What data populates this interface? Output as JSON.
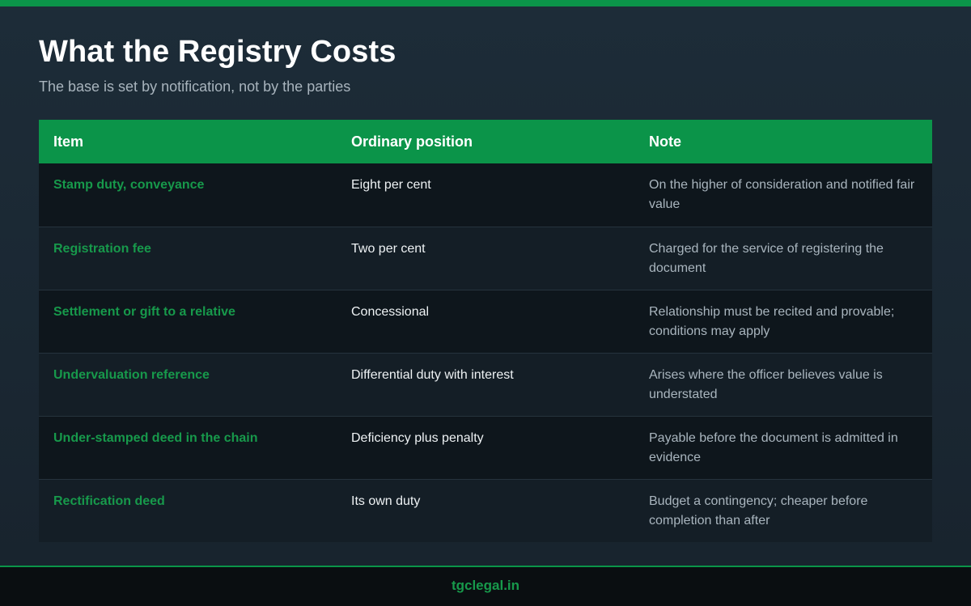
{
  "header": {
    "title": "What the Registry Costs",
    "subtitle": "The base is set by notification, not by the parties"
  },
  "table": {
    "columns": [
      "Item",
      "Ordinary position",
      "Note"
    ],
    "rows": [
      {
        "item": "Stamp duty, conveyance",
        "position": "Eight per cent",
        "note": "On the higher of consideration and notified fair value"
      },
      {
        "item": "Registration fee",
        "position": "Two per cent",
        "note": "Charged for the service of registering the document"
      },
      {
        "item": "Settlement or gift to a relative",
        "position": "Concessional",
        "note": "Relationship must be recited and provable; conditions may apply"
      },
      {
        "item": "Undervaluation reference",
        "position": "Differential duty with interest",
        "note": "Arises where the officer believes value is understated"
      },
      {
        "item": "Under-stamped deed in the chain",
        "position": "Deficiency plus penalty",
        "note": "Payable before the document is admitted in evidence"
      },
      {
        "item": "Rectification deed",
        "position": "Its own duty",
        "note": "Budget a contingency; cheaper before completion than after"
      }
    ]
  },
  "footer": {
    "site": "tgclegal.in"
  },
  "colors": {
    "accent": "#0b9449",
    "item_text": "#17994b",
    "background": "#1d2c38",
    "footer_background": "#0a0e11"
  }
}
